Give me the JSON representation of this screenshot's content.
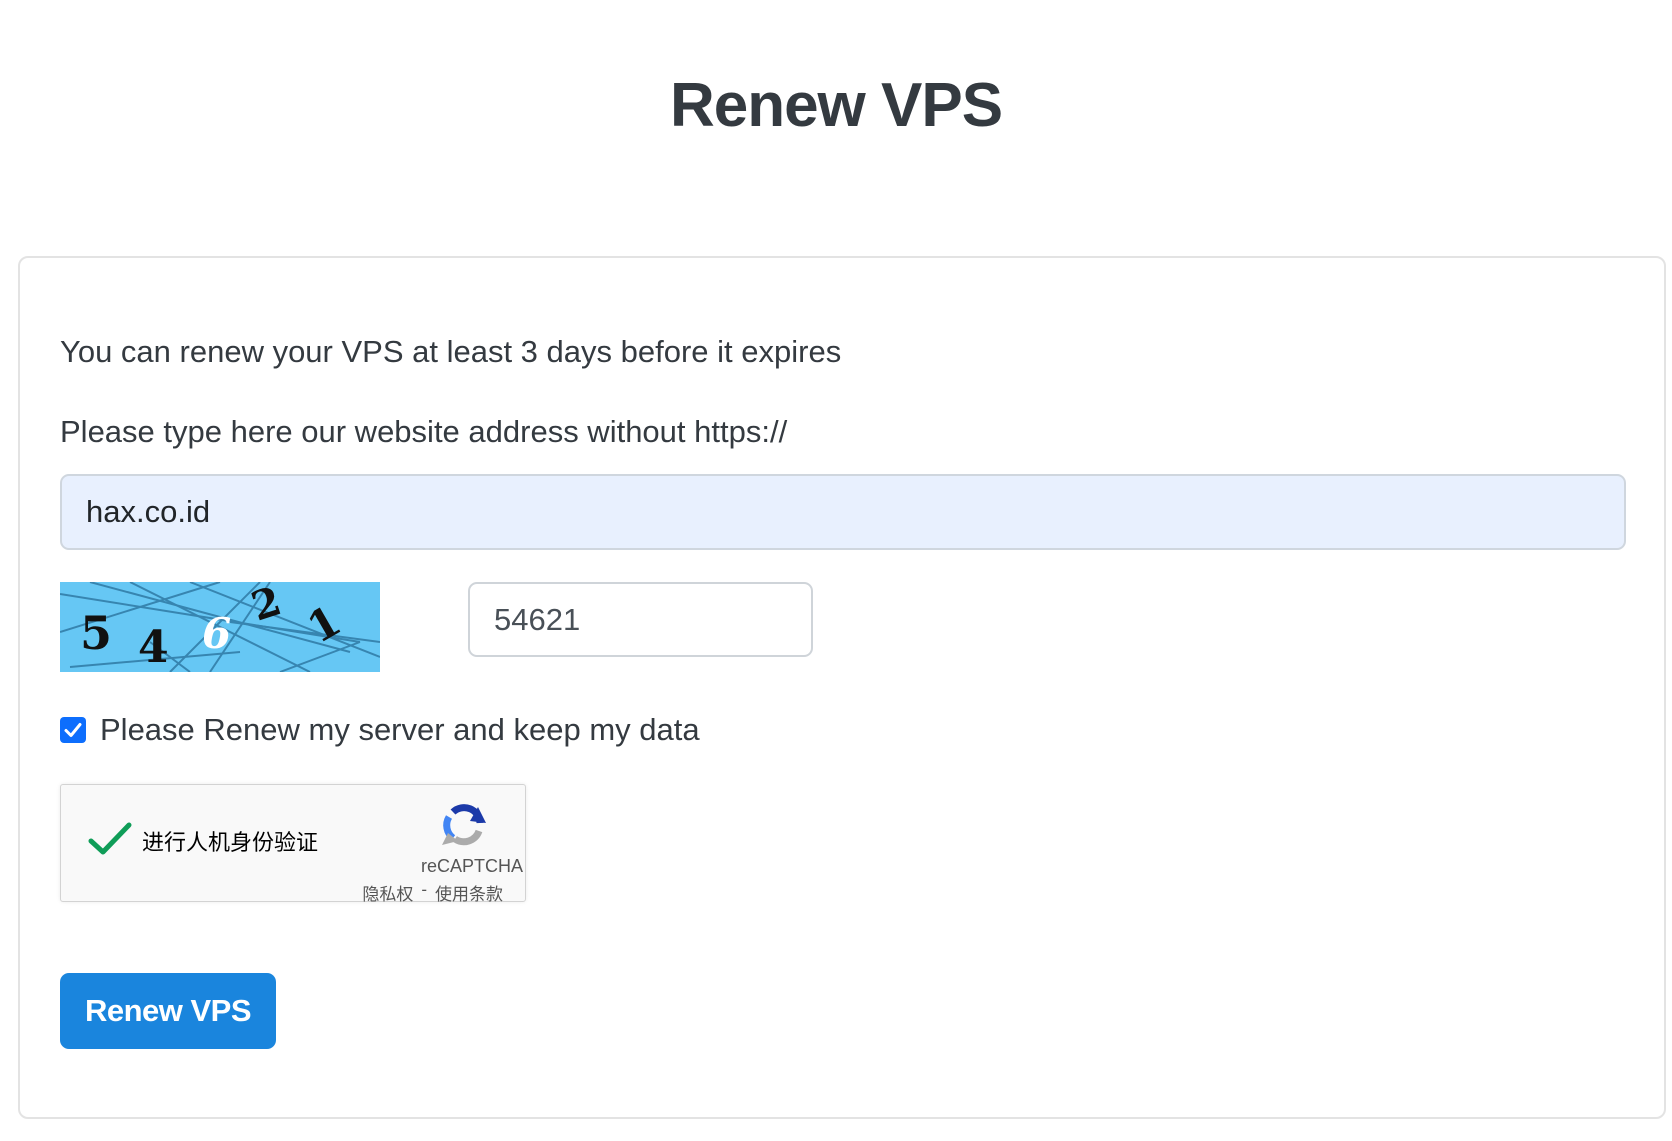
{
  "page": {
    "title": "Renew VPS"
  },
  "form": {
    "intro_text": "You can renew your VPS at least 3 days before it expires",
    "address_label": "Please type here our website address without https://",
    "address_value": "hax.co.id",
    "captcha_image_text": "54621",
    "captcha_input_value": "54621",
    "agree_checked": true,
    "agree_label": "Please Renew my server and keep my data",
    "submit_label": "Renew VPS"
  },
  "recaptcha": {
    "status_text": "进行人机身份验证",
    "brand": "reCAPTCHA",
    "privacy_link": "隐私权",
    "separator": "-",
    "terms_link": "使用条款",
    "verified": true
  },
  "colors": {
    "primary": "#1a85dd",
    "checkbox": "#0d6efd",
    "autofill_bg": "#e8f0fe",
    "captcha_bg": "#66c7f4",
    "recaptcha_check": "#0f9d58"
  },
  "icons": {
    "checkbox": "check-icon",
    "recaptcha_check": "checkmark-icon",
    "recaptcha_logo": "recaptcha-logo-icon"
  }
}
